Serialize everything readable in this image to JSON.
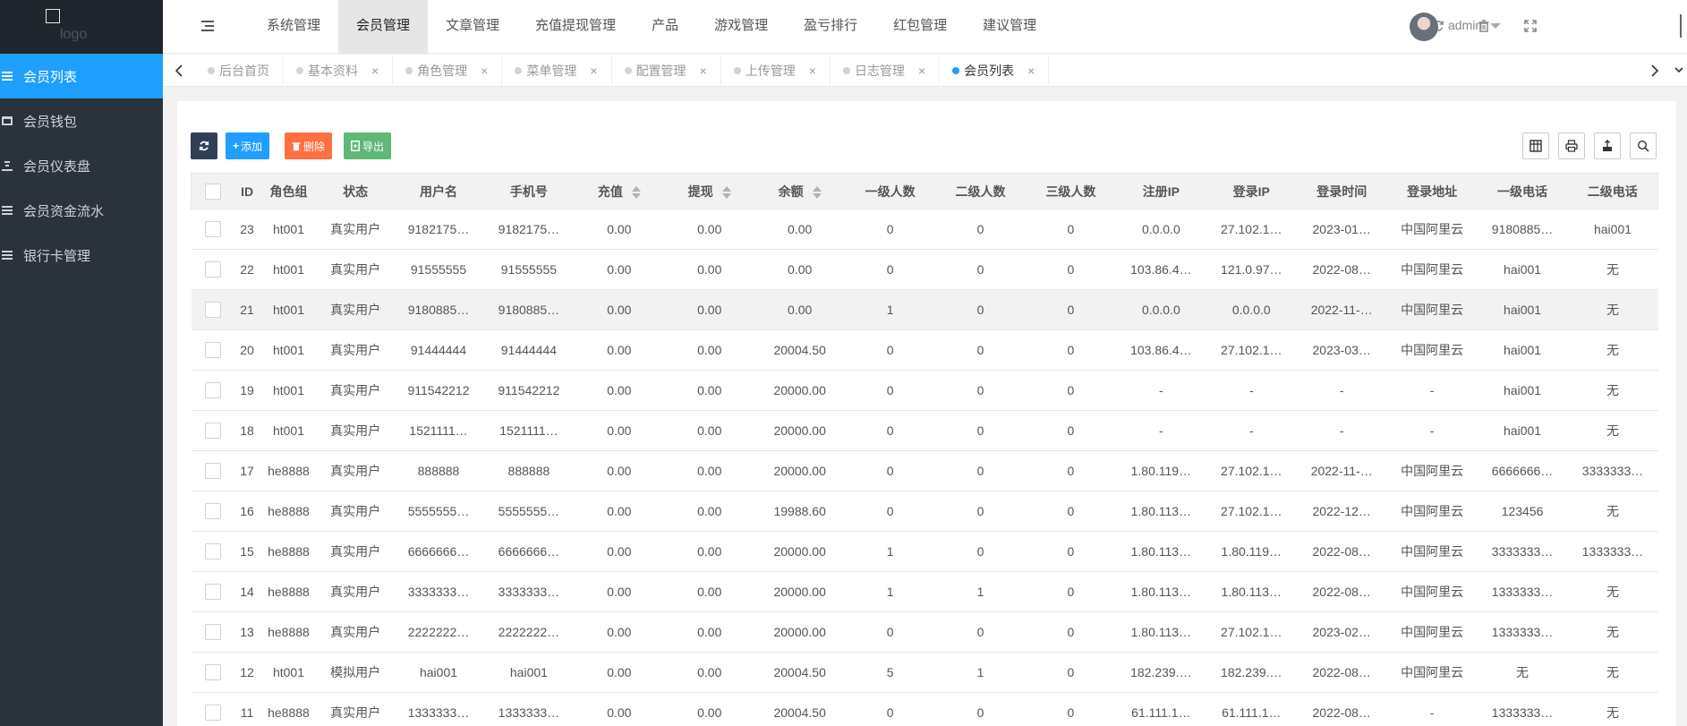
{
  "sidebar": {
    "logo": "logo",
    "items": [
      {
        "label": "会员列表",
        "icon": "list-icon",
        "active": true
      },
      {
        "label": "会员钱包",
        "icon": "wallet-icon",
        "active": false
      },
      {
        "label": "会员仪表盘",
        "icon": "dashboard-icon",
        "active": false
      },
      {
        "label": "会员资金流水",
        "icon": "list-icon",
        "active": false
      },
      {
        "label": "银行卡管理",
        "icon": "list-icon",
        "active": false
      }
    ]
  },
  "header": {
    "nav": [
      "系统管理",
      "会员管理",
      "文章管理",
      "充值提现管理",
      "产品",
      "游戏管理",
      "盈亏排行",
      "红包管理",
      "建议管理"
    ],
    "active_nav": "会员管理",
    "user": "admin",
    "icons": [
      "refresh-icon",
      "clear-cache-icon",
      "fullscreen-icon"
    ]
  },
  "tabs": [
    {
      "label": "后台首页",
      "active": false,
      "closable": false
    },
    {
      "label": "基本资料",
      "active": false,
      "closable": true
    },
    {
      "label": "角色管理",
      "active": false,
      "closable": true
    },
    {
      "label": "菜单管理",
      "active": false,
      "closable": true
    },
    {
      "label": "配置管理",
      "active": false,
      "closable": true
    },
    {
      "label": "上传管理",
      "active": false,
      "closable": true
    },
    {
      "label": "日志管理",
      "active": false,
      "closable": true
    },
    {
      "label": "会员列表",
      "active": true,
      "closable": true
    }
  ],
  "toolbar": {
    "add": "添加",
    "delete": "删除",
    "export": "导出"
  },
  "colors": {
    "sidebar_bg": "#2a323b",
    "accent": "#1e9fff",
    "add_btn": "#1e9fff",
    "delete_btn": "#ff5722",
    "export_btn": "#5fb878",
    "refresh_btn": "#2f4056"
  },
  "table": {
    "columns": [
      "ID",
      "角色组",
      "状态",
      "用户名",
      "手机号",
      "充值",
      "提现",
      "余额",
      "一级人数",
      "二级人数",
      "三级人数",
      "注册IP",
      "登录IP",
      "登录时间",
      "登录地址",
      "一级电话",
      "二级电话"
    ],
    "sortable": [
      "充值",
      "提现",
      "余额"
    ],
    "rows": [
      [
        "23",
        "ht001",
        "真实用户",
        "9182175…",
        "9182175…",
        "0.00",
        "0.00",
        "0.00",
        "0",
        "0",
        "0",
        "0.0.0.0",
        "27.102.1…",
        "2023-01…",
        "中国阿里云",
        "9180885…",
        "hai001"
      ],
      [
        "22",
        "ht001",
        "真实用户",
        "91555555",
        "91555555",
        "0.00",
        "0.00",
        "0.00",
        "0",
        "0",
        "0",
        "103.86.4…",
        "121.0.97…",
        "2022-08…",
        "中国阿里云",
        "hai001",
        "无"
      ],
      [
        "21",
        "ht001",
        "真实用户",
        "9180885…",
        "9180885…",
        "0.00",
        "0.00",
        "0.00",
        "1",
        "0",
        "0",
        "0.0.0.0",
        "0.0.0.0",
        "2022-11-…",
        "中国阿里云",
        "hai001",
        "无"
      ],
      [
        "20",
        "ht001",
        "真实用户",
        "91444444",
        "91444444",
        "0.00",
        "0.00",
        "20004.50",
        "0",
        "0",
        "0",
        "103.86.4…",
        "27.102.1…",
        "2023-03…",
        "中国阿里云",
        "hai001",
        "无"
      ],
      [
        "19",
        "ht001",
        "真实用户",
        "911542212",
        "911542212",
        "0.00",
        "0.00",
        "20000.00",
        "0",
        "0",
        "0",
        "-",
        "-",
        "-",
        "-",
        "hai001",
        "无"
      ],
      [
        "18",
        "ht001",
        "真实用户",
        "1521111…",
        "1521111…",
        "0.00",
        "0.00",
        "20000.00",
        "0",
        "0",
        "0",
        "-",
        "-",
        "-",
        "-",
        "hai001",
        "无"
      ],
      [
        "17",
        "he8888",
        "真实用户",
        "888888",
        "888888",
        "0.00",
        "0.00",
        "20000.00",
        "0",
        "0",
        "0",
        "1.80.119…",
        "27.102.1…",
        "2022-11-…",
        "中国阿里云",
        "6666666…",
        "3333333…"
      ],
      [
        "16",
        "he8888",
        "真实用户",
        "5555555…",
        "5555555…",
        "0.00",
        "0.00",
        "19988.60",
        "0",
        "0",
        "0",
        "1.80.113…",
        "27.102.1…",
        "2022-12…",
        "中国阿里云",
        "123456",
        "无"
      ],
      [
        "15",
        "he8888",
        "真实用户",
        "6666666…",
        "6666666…",
        "0.00",
        "0.00",
        "20000.00",
        "1",
        "0",
        "0",
        "1.80.113…",
        "1.80.119…",
        "2022-08…",
        "中国阿里云",
        "3333333…",
        "1333333…"
      ],
      [
        "14",
        "he8888",
        "真实用户",
        "3333333…",
        "3333333…",
        "0.00",
        "0.00",
        "20000.00",
        "1",
        "1",
        "0",
        "1.80.113…",
        "1.80.113…",
        "2022-08…",
        "中国阿里云",
        "1333333…",
        "无"
      ],
      [
        "13",
        "he8888",
        "真实用户",
        "2222222…",
        "2222222…",
        "0.00",
        "0.00",
        "20000.00",
        "0",
        "0",
        "0",
        "1.80.113…",
        "27.102.1…",
        "2023-02…",
        "中国阿里云",
        "1333333…",
        "无"
      ],
      [
        "12",
        "ht001",
        "模拟用户",
        "hai001",
        "hai001",
        "0.00",
        "0.00",
        "20004.50",
        "5",
        "1",
        "0",
        "182.239.…",
        "182.239.…",
        "2022-08…",
        "中国阿里云",
        "无",
        "无"
      ],
      [
        "11",
        "he8888",
        "真实用户",
        "1333333…",
        "1333333…",
        "0.00",
        "0.00",
        "20004.50",
        "0",
        "0",
        "0",
        "61.111.1…",
        "61.111.1…",
        "2022-08…",
        "-",
        "1333333…",
        "无"
      ]
    ],
    "highlighted_row": 2
  }
}
